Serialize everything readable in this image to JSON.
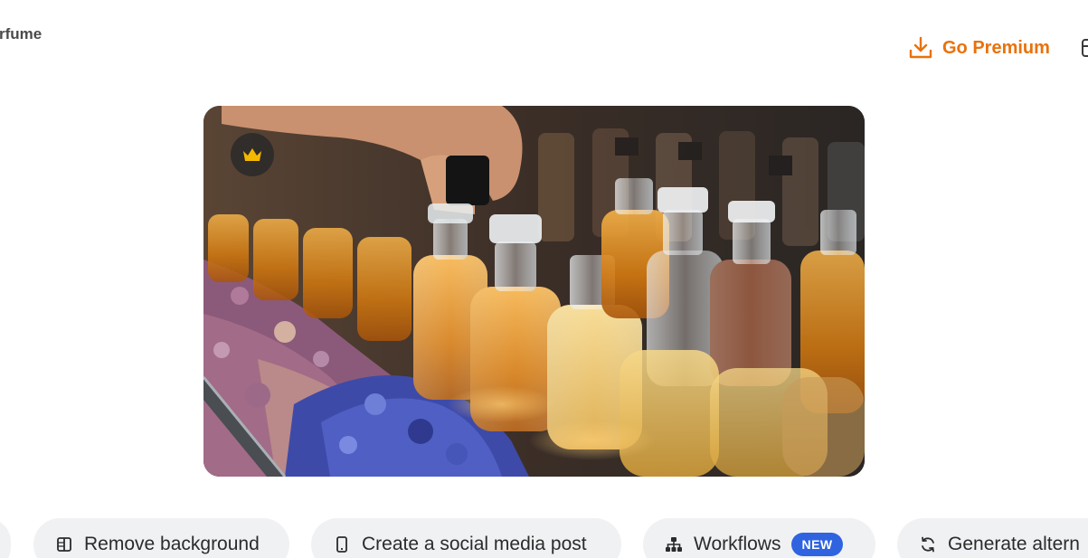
{
  "header": {
    "title_fragment": "rfume",
    "go_premium_label": "Go Premium"
  },
  "colors": {
    "accent": "#e8720c",
    "badge_new": "#2f63e0",
    "chip_bg": "#f0f1f3",
    "premium_crown": "#f5b800"
  },
  "image": {
    "premium_icon": "crown-icon"
  },
  "actions": [
    {
      "label": "",
      "icon": "partial-chip"
    },
    {
      "label": "Remove background",
      "icon": "remove-background-icon"
    },
    {
      "label": "Create a social media post",
      "icon": "phone-icon"
    },
    {
      "label": "Workflows",
      "icon": "workflow-icon",
      "badge": "NEW"
    },
    {
      "label": "Generate altern",
      "icon": "refresh-icon"
    }
  ]
}
